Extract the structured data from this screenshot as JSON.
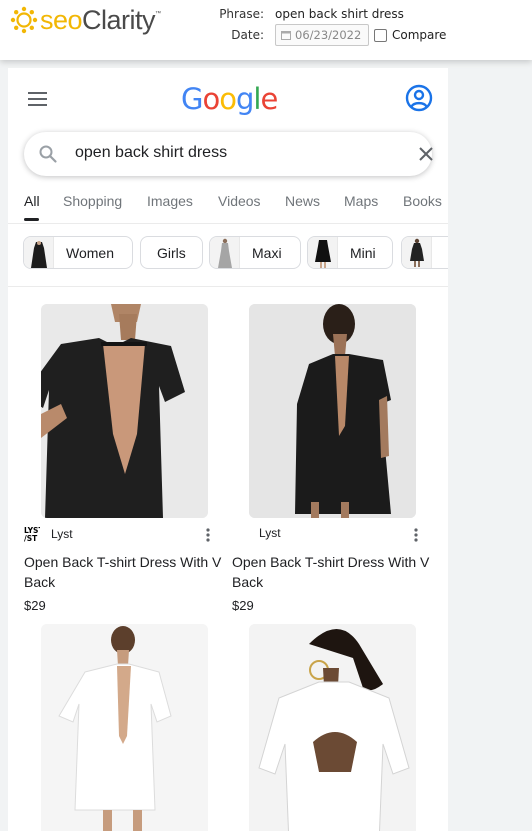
{
  "seo": {
    "brand_seo": "seo",
    "brand_clarity": "Clarity",
    "trademark": "™",
    "phrase_label": "Phrase:",
    "phrase_value": "open back shirt dress",
    "date_label": "Date:",
    "date_value": "06/23/2022",
    "compare_label": "Compare",
    "compare_checked": false,
    "accent": "#f2b705",
    "icons": {
      "logo": "sun-logo-icon",
      "date": "calendar-icon"
    }
  },
  "google": {
    "logo_text": "Google",
    "logo_colors": [
      "#4285f4",
      "#ea4335",
      "#fbbc05",
      "#4285f4",
      "#34a853",
      "#ea4335"
    ],
    "search_query": "open back shirt dress",
    "icons": {
      "menu": "hamburger-menu-icon",
      "account": "account-circle-icon",
      "search": "search-icon",
      "clear": "close-icon"
    },
    "tabs": [
      {
        "label": "All",
        "active": true
      },
      {
        "label": "Shopping"
      },
      {
        "label": "Images"
      },
      {
        "label": "Videos"
      },
      {
        "label": "News"
      },
      {
        "label": "Maps"
      },
      {
        "label": "Books"
      }
    ],
    "chips": [
      {
        "label": "Women",
        "thumb": "black-dress-thumb"
      },
      {
        "label": "Girls"
      },
      {
        "label": "Maxi",
        "thumb": "grey-maxi-dress-thumb"
      },
      {
        "label": "Mini",
        "thumb": "black-mini-dress-thumb"
      },
      {
        "label": "",
        "thumb": "black-dress-thumb"
      }
    ],
    "products": [
      {
        "source": "Lyst",
        "source_logo": "LYST",
        "title": "Open Back T-shirt Dress With V Back",
        "price": "$29"
      },
      {
        "source": "Lyst",
        "title": "Open Back T-shirt Dress With V Back",
        "price": "$29"
      },
      {
        "source": "",
        "title": "",
        "price": ""
      },
      {
        "source": "",
        "title": "",
        "price": ""
      }
    ]
  }
}
